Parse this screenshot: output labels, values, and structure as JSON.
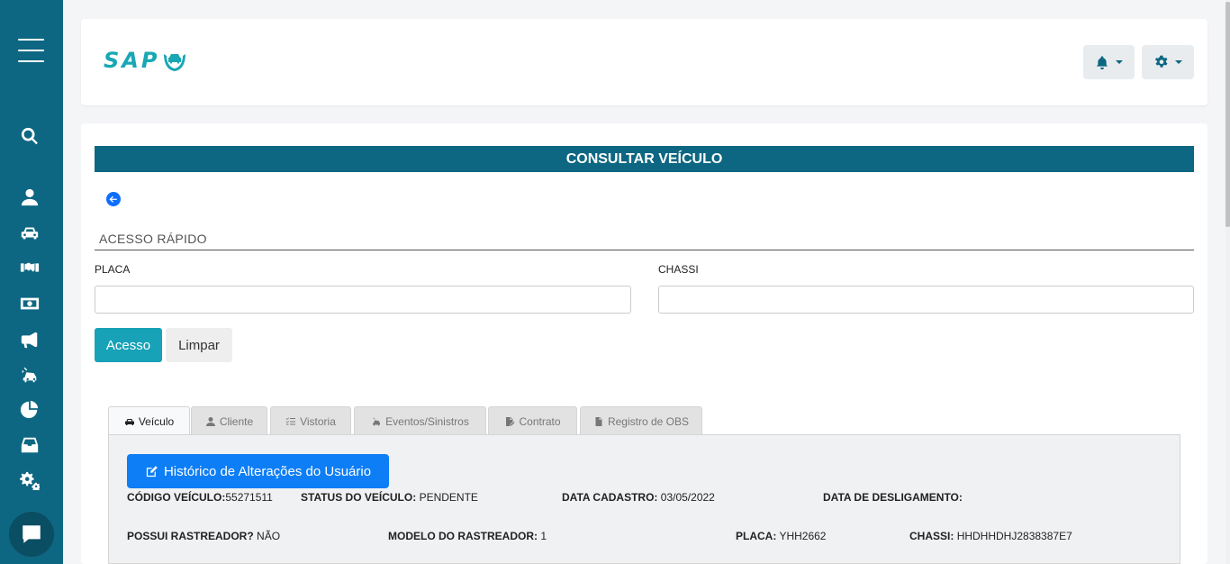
{
  "header": {
    "logo_text": "SAP",
    "bell_icon": "bell-icon",
    "settings_icon": "gear-icon"
  },
  "sidebar": {
    "items": [
      {
        "icon": "search-icon"
      },
      {
        "icon": "user-icon"
      },
      {
        "icon": "car-icon"
      },
      {
        "icon": "handshake-icon"
      },
      {
        "icon": "money-icon"
      },
      {
        "icon": "megaphone-icon"
      },
      {
        "icon": "car-crash-icon"
      },
      {
        "icon": "pie-chart-icon"
      },
      {
        "icon": "inbox-icon"
      },
      {
        "icon": "cogs-icon"
      }
    ]
  },
  "page": {
    "title": "CONSULTAR VEÍCULO",
    "section_title": "ACESSO RÁPIDO",
    "placa_label": "PLACA",
    "chassi_label": "CHASSI",
    "placa_value": "",
    "chassi_value": "",
    "acesso_button": "Acesso",
    "limpar_button": "Limpar"
  },
  "tabs": [
    {
      "label": "Veículo",
      "icon": "car-icon",
      "active": true
    },
    {
      "label": "Cliente",
      "icon": "user-icon",
      "active": false
    },
    {
      "label": "Vistoria",
      "icon": "checklist-icon",
      "active": false
    },
    {
      "label": "Eventos/Sinistros",
      "icon": "car-crash-icon",
      "active": false
    },
    {
      "label": "Contrato",
      "icon": "file-signature-icon",
      "active": false
    },
    {
      "label": "Registro de OBS",
      "icon": "file-icon",
      "active": false
    }
  ],
  "vehicle": {
    "historico_button": "Histórico de Alterações do Usuário",
    "codigo_label": "CÓDIGO VEÍCULO:",
    "codigo_value": "55271511",
    "status_label": "STATUS DO VEÍCULO:",
    "status_value": "PENDENTE",
    "cadastro_label": "DATA CADASTRO:",
    "cadastro_value": "03/05/2022",
    "desligamento_label": "DATA DE DESLIGAMENTO:",
    "desligamento_value": "",
    "rastreador_label": "POSSUI RASTREADOR?",
    "rastreador_value": "NÃO",
    "modelo_label": "MODELO DO RASTREADOR:",
    "modelo_value": "1",
    "placa_label": "PLACA:",
    "placa_value": "YHH2662",
    "chassi_label": "CHASSI:",
    "chassi_value": "HHDHHDHJ2838387E7"
  },
  "colors": {
    "sidebar": "#0d6782",
    "title_bar": "#0d6782",
    "accent": "#17a2b8",
    "primary": "#0d7ef5"
  }
}
